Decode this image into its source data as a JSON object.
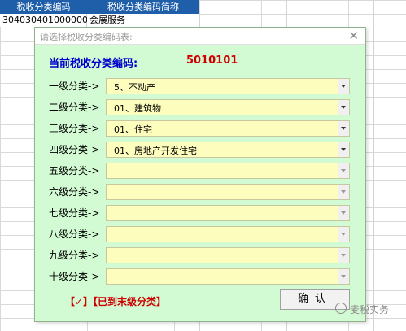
{
  "sheet": {
    "headers": [
      "税收分类编码",
      "税收分类编码简称"
    ],
    "row1": [
      "3040304010000000000",
      "会展服务"
    ]
  },
  "dialog": {
    "title": "请选择税收分类编码表:",
    "current_label": "当前税收分类编码:",
    "current_code": "5010101",
    "levels": [
      {
        "label": "一级分类->",
        "value": "5、不动产"
      },
      {
        "label": "二级分类->",
        "value": "01、建筑物"
      },
      {
        "label": "三级分类->",
        "value": "01、住宅"
      },
      {
        "label": "四级分类->",
        "value": "01、房地产开发住宅"
      },
      {
        "label": "五级分类->",
        "value": ""
      },
      {
        "label": "六级分类->",
        "value": ""
      },
      {
        "label": "七级分类->",
        "value": ""
      },
      {
        "label": "八级分类->",
        "value": ""
      },
      {
        "label": "九级分类->",
        "value": ""
      },
      {
        "label": "十级分类->",
        "value": ""
      }
    ],
    "status_text": "【✓】【已到末级分类】",
    "confirm_label": "确认",
    "close_icon": "close-icon"
  },
  "watermark": "麦税实务"
}
